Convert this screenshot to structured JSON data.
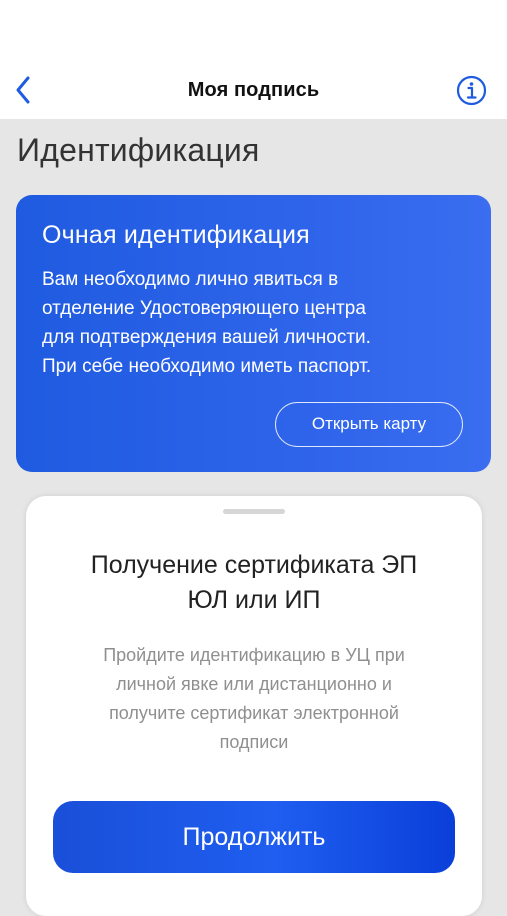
{
  "nav": {
    "title": "Моя подпись"
  },
  "page": {
    "title": "Идентификация"
  },
  "card": {
    "title": "Очная идентификация",
    "lines": [
      "Вам необходимо лично явиться в",
      "отделение Удостоверяющего центра",
      "для подтверждения вашей личности.",
      "При себе необходимо иметь паспорт."
    ],
    "button_label": "Открыть карту"
  },
  "sheet": {
    "title_lines": [
      "Получение сертификата ЭП",
      "ЮЛ или ИП"
    ],
    "text_lines": [
      "Пройдите идентификацию в УЦ при",
      "личной явке или дистанционно и",
      "получите сертификат электронной",
      "подписи"
    ],
    "button_label": "Продолжить"
  },
  "icons": {
    "back": "chevron-left-icon",
    "info": "info-circle-icon"
  },
  "colors": {
    "accent": "#1f5be0",
    "background": "#e6e6e6"
  }
}
